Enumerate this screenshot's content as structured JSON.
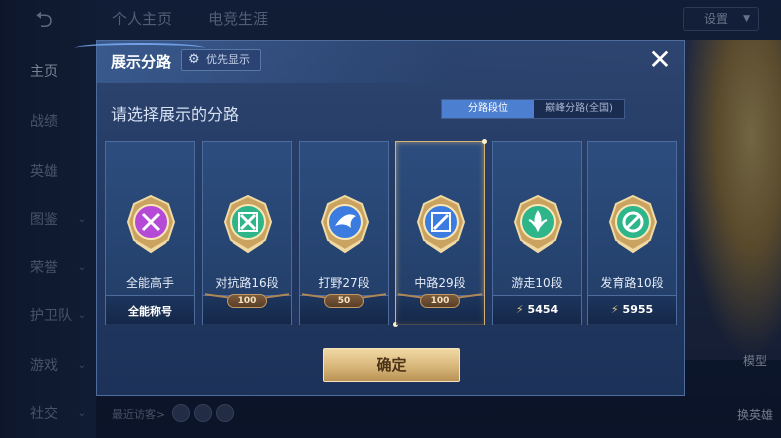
{
  "background": {
    "nav": [
      {
        "label": "主页",
        "active": true
      },
      {
        "label": "战绩"
      },
      {
        "label": "英雄"
      },
      {
        "label": "图鉴",
        "chev": true
      },
      {
        "label": "荣誉",
        "chev": true
      },
      {
        "label": "护卫队",
        "chev": true
      },
      {
        "label": "游戏",
        "chev": true
      },
      {
        "label": "社交",
        "chev": true
      }
    ],
    "top_tabs": [
      "个人主页",
      "电竞生涯"
    ],
    "settings_label": "设置",
    "right_labels": [
      "模型",
      "换英雄"
    ],
    "visitors_label": "最近访客>"
  },
  "modal": {
    "title": "展示分路",
    "priority_label": "优先显示",
    "close_symbol": "✕",
    "subtitle": "请选择展示的分路",
    "segment": {
      "options": [
        "分路段位",
        "巅峰分路(全国)"
      ],
      "selected": 0
    },
    "cards": [
      {
        "label": "全能高手",
        "foot_type": "text",
        "foot": "全能称号",
        "emblem": "allround-emblem",
        "color": "#b44ad6"
      },
      {
        "label": "对抗路16段",
        "foot_type": "tier",
        "foot": "100",
        "emblem": "clash-lane-emblem",
        "color": "#2fb58a"
      },
      {
        "label": "打野27段",
        "foot_type": "tier",
        "foot": "50",
        "emblem": "jungle-emblem",
        "color": "#3c7be0"
      },
      {
        "label": "中路29段",
        "foot_type": "tier",
        "foot": "100",
        "emblem": "mid-lane-emblem",
        "color": "#3c7be0",
        "selected": true
      },
      {
        "label": "游走10段",
        "foot_type": "score",
        "foot": "5454",
        "emblem": "roam-emblem",
        "color": "#2fb58a"
      },
      {
        "label": "发育路10段",
        "foot_type": "score",
        "foot": "5955",
        "emblem": "farm-lane-emblem",
        "color": "#2fb58a"
      }
    ],
    "confirm_label": "确定"
  }
}
